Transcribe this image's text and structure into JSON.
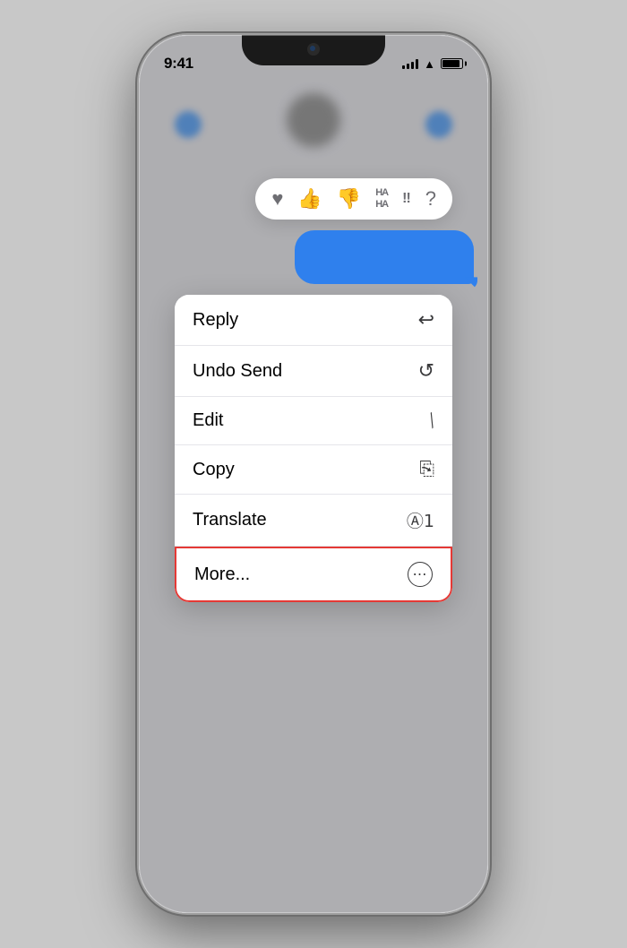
{
  "phone": {
    "status_bar": {
      "time": "9:41"
    },
    "reaction_bar": {
      "items": [
        {
          "id": "heart",
          "symbol": "♥",
          "label": "Heart"
        },
        {
          "id": "thumbsup",
          "symbol": "👍",
          "label": "Thumbs Up"
        },
        {
          "id": "thumbsdown",
          "symbol": "👎",
          "label": "Thumbs Down"
        },
        {
          "id": "haha",
          "symbol": "HAHA",
          "label": "Haha"
        },
        {
          "id": "exclaim",
          "symbol": "‼",
          "label": "Exclamation"
        },
        {
          "id": "question",
          "symbol": "?",
          "label": "Question"
        }
      ]
    },
    "context_menu": {
      "items": [
        {
          "id": "reply",
          "label": "Reply",
          "icon": "↩"
        },
        {
          "id": "undo-send",
          "label": "Undo Send",
          "icon": "↺"
        },
        {
          "id": "edit",
          "label": "Edit",
          "icon": "✏"
        },
        {
          "id": "copy",
          "label": "Copy",
          "icon": "⧉"
        },
        {
          "id": "translate",
          "label": "Translate",
          "icon": "⊛"
        },
        {
          "id": "more",
          "label": "More...",
          "icon": "⊙",
          "highlighted": true
        }
      ]
    }
  }
}
